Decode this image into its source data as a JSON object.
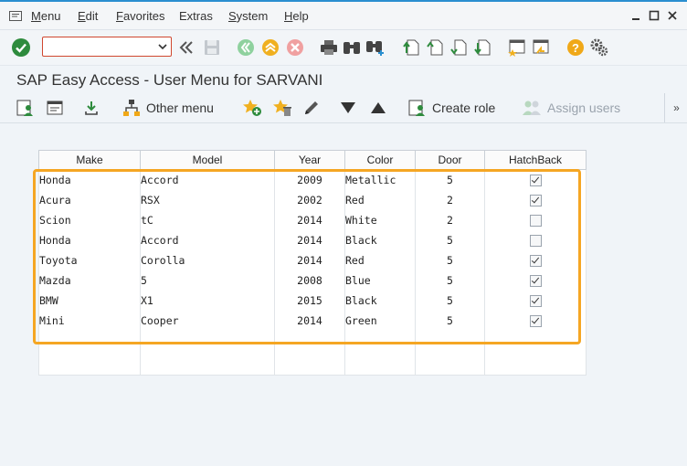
{
  "menubar": {
    "items": [
      {
        "mnemonic": "M",
        "rest": "enu"
      },
      {
        "mnemonic": "E",
        "rest": "dit"
      },
      {
        "mnemonic": "F",
        "rest": "avorites"
      },
      {
        "mnemonic": "",
        "rest": "Extras"
      },
      {
        "mnemonic": "S",
        "rest": "ystem"
      },
      {
        "mnemonic": "H",
        "rest": "elp"
      }
    ]
  },
  "toolbar": {
    "command_field_value": ""
  },
  "title": "SAP Easy Access  -  User Menu for SARVANI",
  "app_toolbar": {
    "other_menu": "Other menu",
    "create_role": "Create role",
    "assign_users": "Assign users",
    "more": "»"
  },
  "table": {
    "columns": [
      "Make",
      "Model",
      "Year",
      "Color",
      "Door",
      "HatchBack"
    ],
    "rows": [
      {
        "make": "Honda",
        "model": "Accord",
        "year": "2009",
        "color": "Metallic",
        "door": "5",
        "hatchback": true
      },
      {
        "make": "Acura",
        "model": "RSX",
        "year": "2002",
        "color": "Red",
        "door": "2",
        "hatchback": true
      },
      {
        "make": "Scion",
        "model": "tC",
        "year": "2014",
        "color": "White",
        "door": "2",
        "hatchback": false
      },
      {
        "make": "Honda",
        "model": "Accord",
        "year": "2014",
        "color": "Black",
        "door": "5",
        "hatchback": false
      },
      {
        "make": "Toyota",
        "model": "Corolla",
        "year": "2014",
        "color": "Red",
        "door": "5",
        "hatchback": true
      },
      {
        "make": "Mazda",
        "model": "5",
        "year": "2008",
        "color": "Blue",
        "door": "5",
        "hatchback": true
      },
      {
        "make": "BMW",
        "model": "X1",
        "year": "2015",
        "color": "Black",
        "door": "5",
        "hatchback": true
      },
      {
        "make": "Mini",
        "model": "Cooper",
        "year": "2014",
        "color": "Green",
        "door": "5",
        "hatchback": true
      }
    ]
  },
  "colors": {
    "highlight": "#f5a623",
    "accent": "#2a8fd0"
  }
}
